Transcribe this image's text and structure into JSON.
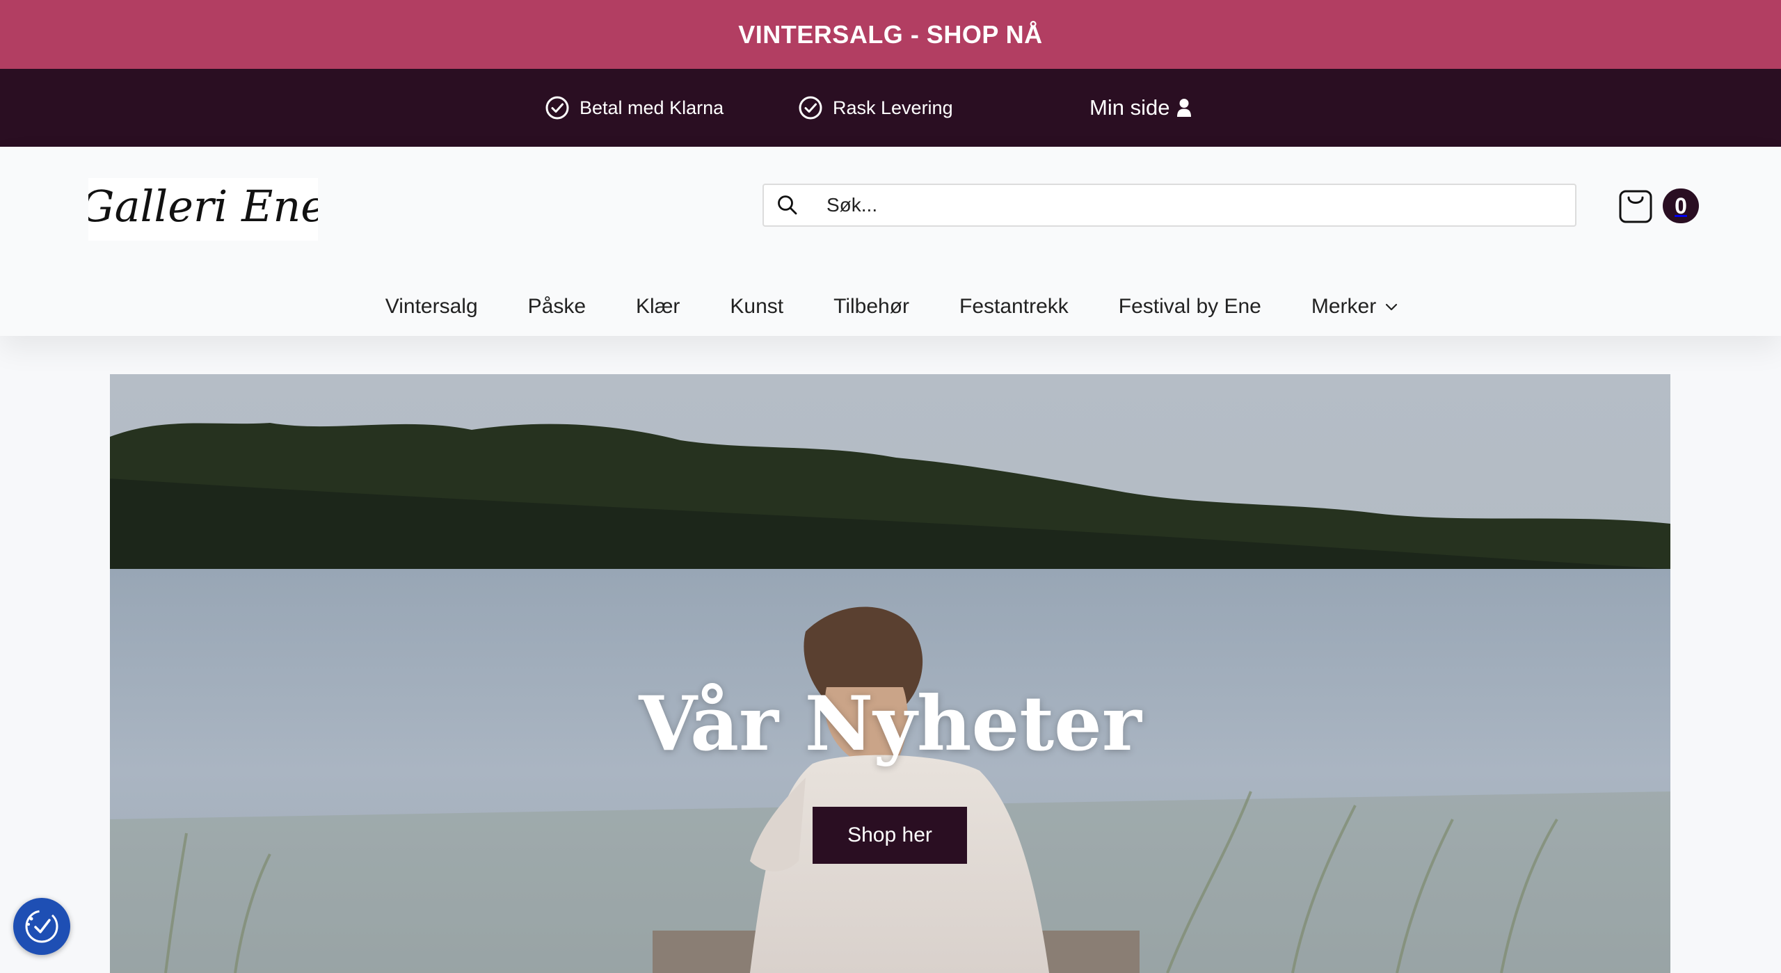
{
  "promo": {
    "text": "VINTERSALG - SHOP NÅ",
    "color": "#b23e62"
  },
  "usp": {
    "items": [
      {
        "label": "Betal med Klarna",
        "icon": "check-circle-icon"
      },
      {
        "label": "Rask Levering",
        "icon": "check-circle-icon"
      }
    ],
    "account_label": "Min side",
    "account_icon": "user-icon",
    "background": "#2a0e22"
  },
  "header": {
    "logo_text": "Galleri Ene",
    "search_placeholder": "Søk...",
    "cart_count": "0",
    "cart_icon": "shopping-bag-icon"
  },
  "nav": {
    "items": [
      "Vintersalg",
      "Påske",
      "Klær",
      "Kunst",
      "Tilbehør",
      "Festantrekk",
      "Festival by Ene",
      "Merker"
    ]
  },
  "hero": {
    "title": "Vår Nyheter",
    "button_label": "Shop her"
  },
  "accessibility": {
    "icon": "accessibility-icon",
    "color": "#1e4fb4"
  }
}
